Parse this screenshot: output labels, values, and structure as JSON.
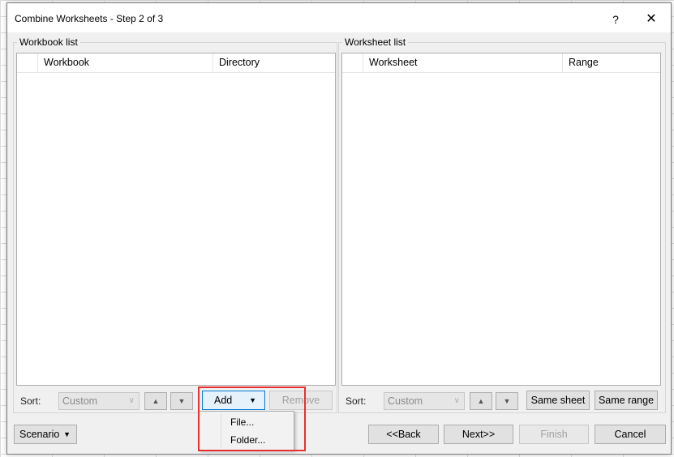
{
  "dialog": {
    "title": "Combine Worksheets - Step 2 of 3",
    "help_glyph": "?",
    "close_glyph": "✕"
  },
  "workbook_panel": {
    "legend": "Workbook list",
    "columns": [
      "Workbook",
      "Directory"
    ],
    "sort_label": "Sort:",
    "sort_value": "Custom",
    "up_glyph": "▲",
    "down_glyph": "▼",
    "add_label": "Add",
    "remove_label": "Remove"
  },
  "worksheet_panel": {
    "legend": "Worksheet list",
    "columns": [
      "Worksheet",
      "Range"
    ],
    "sort_label": "Sort:",
    "sort_value": "Custom",
    "up_glyph": "▲",
    "down_glyph": "▼",
    "same_sheet_label": "Same sheet",
    "same_range_label": "Same range"
  },
  "add_menu": {
    "items": [
      "File...",
      "Folder..."
    ]
  },
  "footer": {
    "scenario_label": "Scenario",
    "back_label": "<<Back",
    "next_label": "Next>>",
    "finish_label": "Finish",
    "cancel_label": "Cancel"
  },
  "colors": {
    "highlight": "#e8312f",
    "add_accent": "#0078d7"
  }
}
